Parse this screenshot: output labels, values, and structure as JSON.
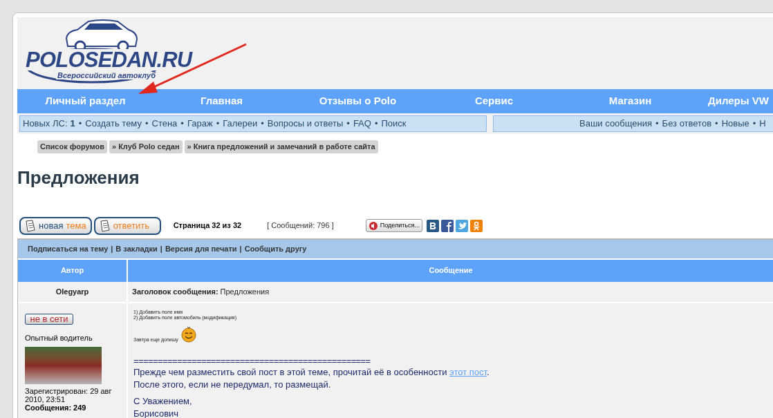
{
  "logo": {
    "name": "POLOSEDAN.RU",
    "tagline": "Всероссийский автоклуб"
  },
  "nav": [
    "Личный раздел",
    "Главная",
    "Отзывы о Polo",
    "Сервис",
    "Магазин",
    "Дилеры VW"
  ],
  "link_separator": "•",
  "quick_links_left": {
    "pm_label": "Новых ЛС:",
    "pm_count": "1",
    "links": [
      "Создать тему",
      "Стена",
      "Гараж",
      "Галереи",
      "Вопросы и ответы",
      "FAQ",
      "Поиск"
    ]
  },
  "quick_links_right": [
    "Ваши сообщения",
    "Без ответов",
    "Новые",
    "Н"
  ],
  "breadcrumbs": [
    "Список форумов",
    "» Клуб Polo седан",
    "» Книга предложений и замечаний в работе сайта"
  ],
  "page_title": "Предложения",
  "actions": [
    {
      "parts": [
        {
          "text": "новая",
          "accent": false
        },
        {
          "text": "тема",
          "accent": true
        }
      ]
    },
    {
      "parts": [
        {
          "text": "ответить",
          "accent": true
        }
      ]
    }
  ],
  "pagination": "Страница 32 из 32",
  "post_count": "[ Сообщений: 796 ]",
  "share_button": "Поделиться...",
  "topic_separator": "|",
  "topic_links": [
    "Подписаться на тему",
    "В закладки",
    "Версия для печати",
    "Сообщить другу"
  ],
  "table": {
    "columns": [
      "Автор",
      "Сообщение"
    ],
    "post": {
      "author": "Olegyarp",
      "subject_label": "Заголовок сообщения:",
      "subject": "Предложения",
      "status": "не в сети",
      "online": false,
      "rank": "Опытный водитель",
      "registered": "Зарегистрирован: 29 авг 2010, 23:51",
      "posts": "Сообщения: 249",
      "small_lines": [
        "1) Добавить поле имя",
        "2) Добавить поле автомобиль (модификация)"
      ],
      "small_note": "Завтра еще допишу",
      "separator": "=================================================",
      "notice_before": "Прежде чем разместить свой пост в этой теме, прочитай её в особенности",
      "notice_link": "этот пост",
      "notice_after": ".",
      "notice_line_2": "После этого, если не передумал, то размещай.",
      "signature": [
        "С Уважением,",
        "Борисович"
      ]
    }
  }
}
